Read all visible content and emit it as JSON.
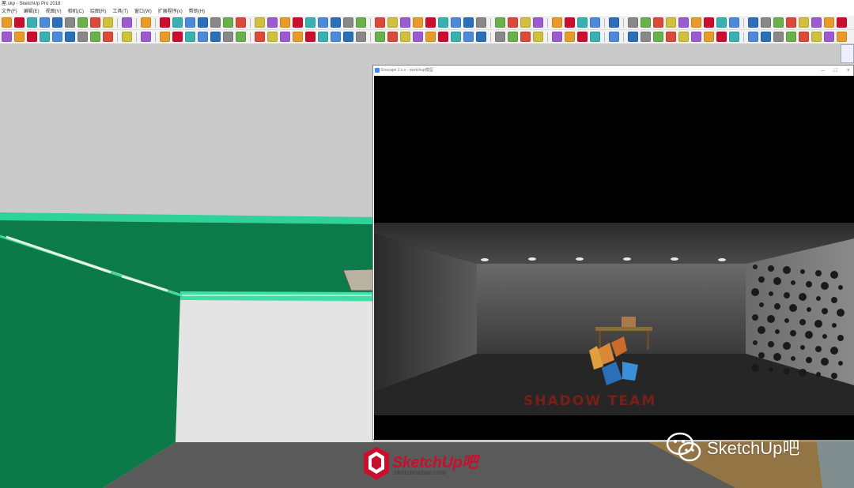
{
  "window": {
    "title": "屋.skp - SketchUp Pro 2018"
  },
  "menu": [
    "文件(F)",
    "编辑(E)",
    "视图(V)",
    "相机(C)",
    "绘图(R)",
    "工具(T)",
    "窗口(W)",
    "扩展程序(x)",
    "帮助(H)"
  ],
  "render_window": {
    "title": "Enscape 2.x.x - sketchup模型"
  },
  "watermark": "SHADOW TEAM",
  "logos": {
    "sketchup_brand": "SketchUp吧",
    "sketchup_url": "sketchupbar.com",
    "wechat_account": "SketchUp吧"
  },
  "colors": {
    "green_wall": "#0a7a4a",
    "render_bg": "#000000",
    "brand_red": "#c8102e"
  }
}
